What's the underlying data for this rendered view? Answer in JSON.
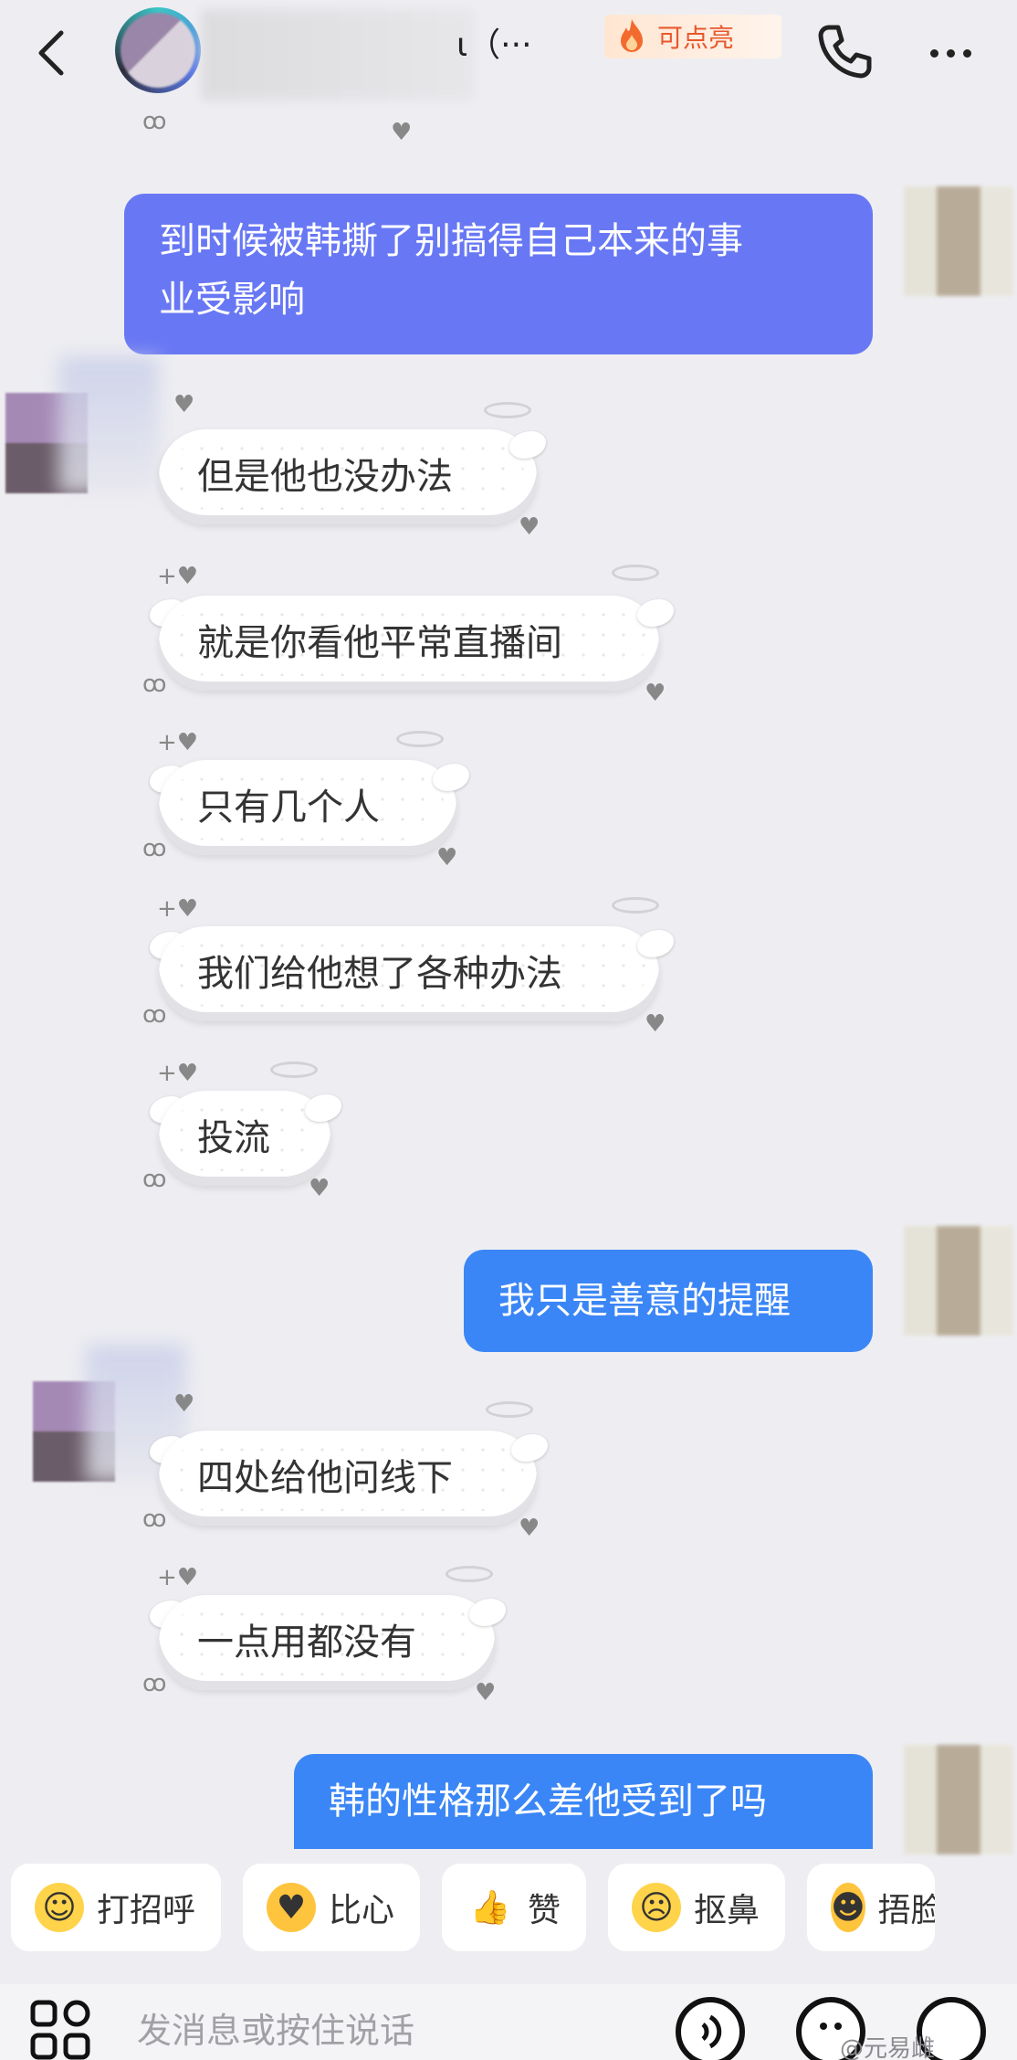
{
  "header": {
    "title_fragment": "ι（···",
    "badge_label": "可点亮"
  },
  "messages": [
    {
      "side": "sent",
      "text_line1": "到时候被韩撕了别搞得自己本来的事",
      "text_line2": "业受影响"
    },
    {
      "side": "recv",
      "text": "但是他也没办法"
    },
    {
      "side": "recv",
      "text": "就是你看他平常直播间"
    },
    {
      "side": "recv",
      "text": "只有几个人"
    },
    {
      "side": "recv",
      "text": "我们给他想了各种办法"
    },
    {
      "side": "recv",
      "text": "投流"
    },
    {
      "side": "sent",
      "text": "我只是善意的提醒"
    },
    {
      "side": "recv",
      "text": "四处给他问线下"
    },
    {
      "side": "recv",
      "text": "一点用都没有"
    },
    {
      "side": "sent",
      "text": "韩的性格那么差他受到了吗"
    }
  ],
  "quick_replies": [
    {
      "label": "打招呼",
      "icon": "greeting-emoji-icon"
    },
    {
      "label": "比心",
      "icon": "heart-hands-emoji-icon"
    },
    {
      "label": "赞",
      "icon": "thumbs-up-icon"
    },
    {
      "label": "抠鼻",
      "icon": "nose-pick-emoji-icon"
    },
    {
      "label": "捂脸",
      "icon": "facepalm-emoji-icon"
    }
  ],
  "input": {
    "placeholder": "发消息或按住说话"
  },
  "watermark": "@元易雌",
  "colors": {
    "sent_purple": "#6878f4",
    "sent_blue": "#3b86f6",
    "background": "#eeeef2",
    "badge_text": "#e8582c"
  }
}
